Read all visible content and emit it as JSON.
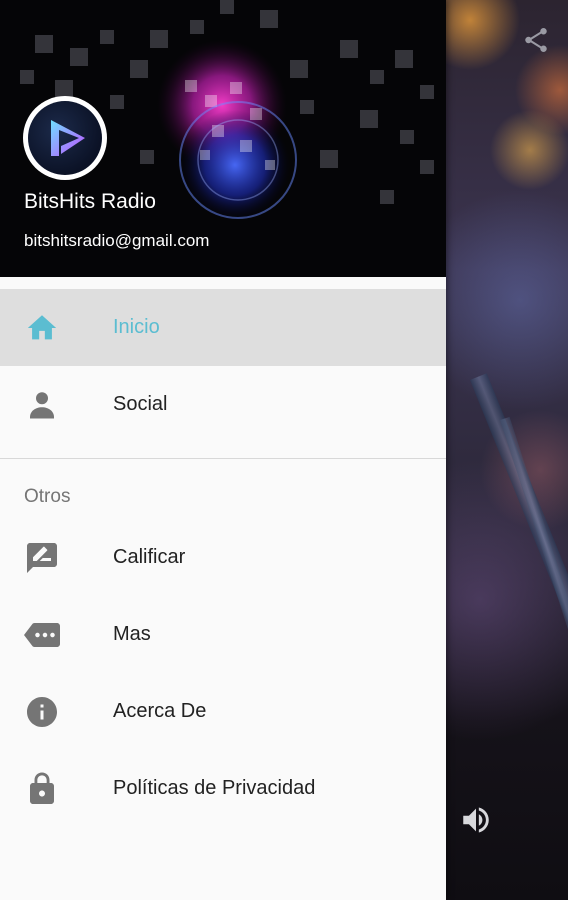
{
  "header": {
    "app_name": "BitsHits Radio",
    "email": "bitshitsradio@gmail.com"
  },
  "menu_main": [
    {
      "label": "Inicio",
      "icon": "home-icon",
      "active": true
    },
    {
      "label": "Social",
      "icon": "person-icon",
      "active": false
    }
  ],
  "section": {
    "title": "Otros"
  },
  "menu_other": [
    {
      "label": "Calificar",
      "icon": "rate-review-icon"
    },
    {
      "label": "Mas",
      "icon": "more-tag-icon"
    },
    {
      "label": "Acerca De",
      "icon": "info-icon"
    },
    {
      "label": "Políticas de Privacidad",
      "icon": "lock-icon"
    }
  ],
  "colors": {
    "accent": "#5bbdd1",
    "icon_gray": "#757575",
    "active_bg": "#dedede",
    "drawer_bg": "#fafafa"
  }
}
